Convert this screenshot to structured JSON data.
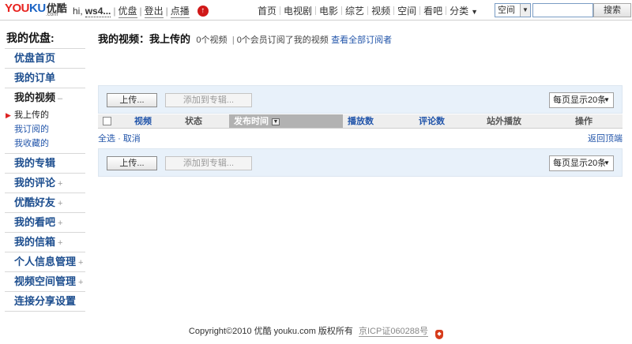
{
  "header": {
    "logo_en_y": "YOU",
    "logo_en_k": "KU",
    "logo_cn": "优酷",
    "logo_dotcom": ".com",
    "greeting": "hi,",
    "username": "ws4...",
    "links": [
      "优盘",
      "登出",
      "点播"
    ],
    "nav": [
      "首页",
      "电视剧",
      "电影",
      "综艺",
      "视频",
      "空间",
      "看吧"
    ],
    "nav_more": "分类",
    "search_scope": "空间",
    "search_placeholder": "",
    "search_button": "搜索"
  },
  "sidebar": {
    "title": "我的优盘:",
    "items_top": [
      {
        "label": "优盘首页",
        "plus": ""
      },
      {
        "label": "我的订单",
        "plus": ""
      }
    ],
    "open_item": {
      "label": "我的视频",
      "marker": "–"
    },
    "sub_items": [
      "我上传的",
      "我订阅的",
      "我收藏的"
    ],
    "items_bottom": [
      {
        "label": "我的专辑",
        "plus": ""
      },
      {
        "label": "我的评论",
        "plus": "+"
      },
      {
        "label": "优酷好友",
        "plus": "+"
      },
      {
        "label": "我的看吧",
        "plus": "+"
      },
      {
        "label": "我的信箱",
        "plus": "+"
      },
      {
        "label": "个人信息管理",
        "plus": "+"
      },
      {
        "label": "视频空间管理",
        "plus": "+"
      },
      {
        "label": "连接分享设置",
        "plus": ""
      }
    ]
  },
  "main": {
    "title": "我的视频：我上传的",
    "video_count": "0个视频",
    "sep": "|",
    "subscribers": "0个会员订阅了我的视频",
    "view_all": "查看全部订阅者",
    "upload_button": "上传...",
    "add_album_button": "添加到专辑...",
    "per_page": "每页显示20条",
    "columns": [
      "视频",
      "状态",
      "发布时间",
      "播放数",
      "评论数",
      "站外播放",
      "操作"
    ],
    "select_all": "全选",
    "cancel": "· 取消",
    "back_top": "返回顶端"
  },
  "footer": {
    "copyright": "Copyright©2010 优酷  youku.com 版权所有",
    "icp": "京ICP证060288号"
  }
}
